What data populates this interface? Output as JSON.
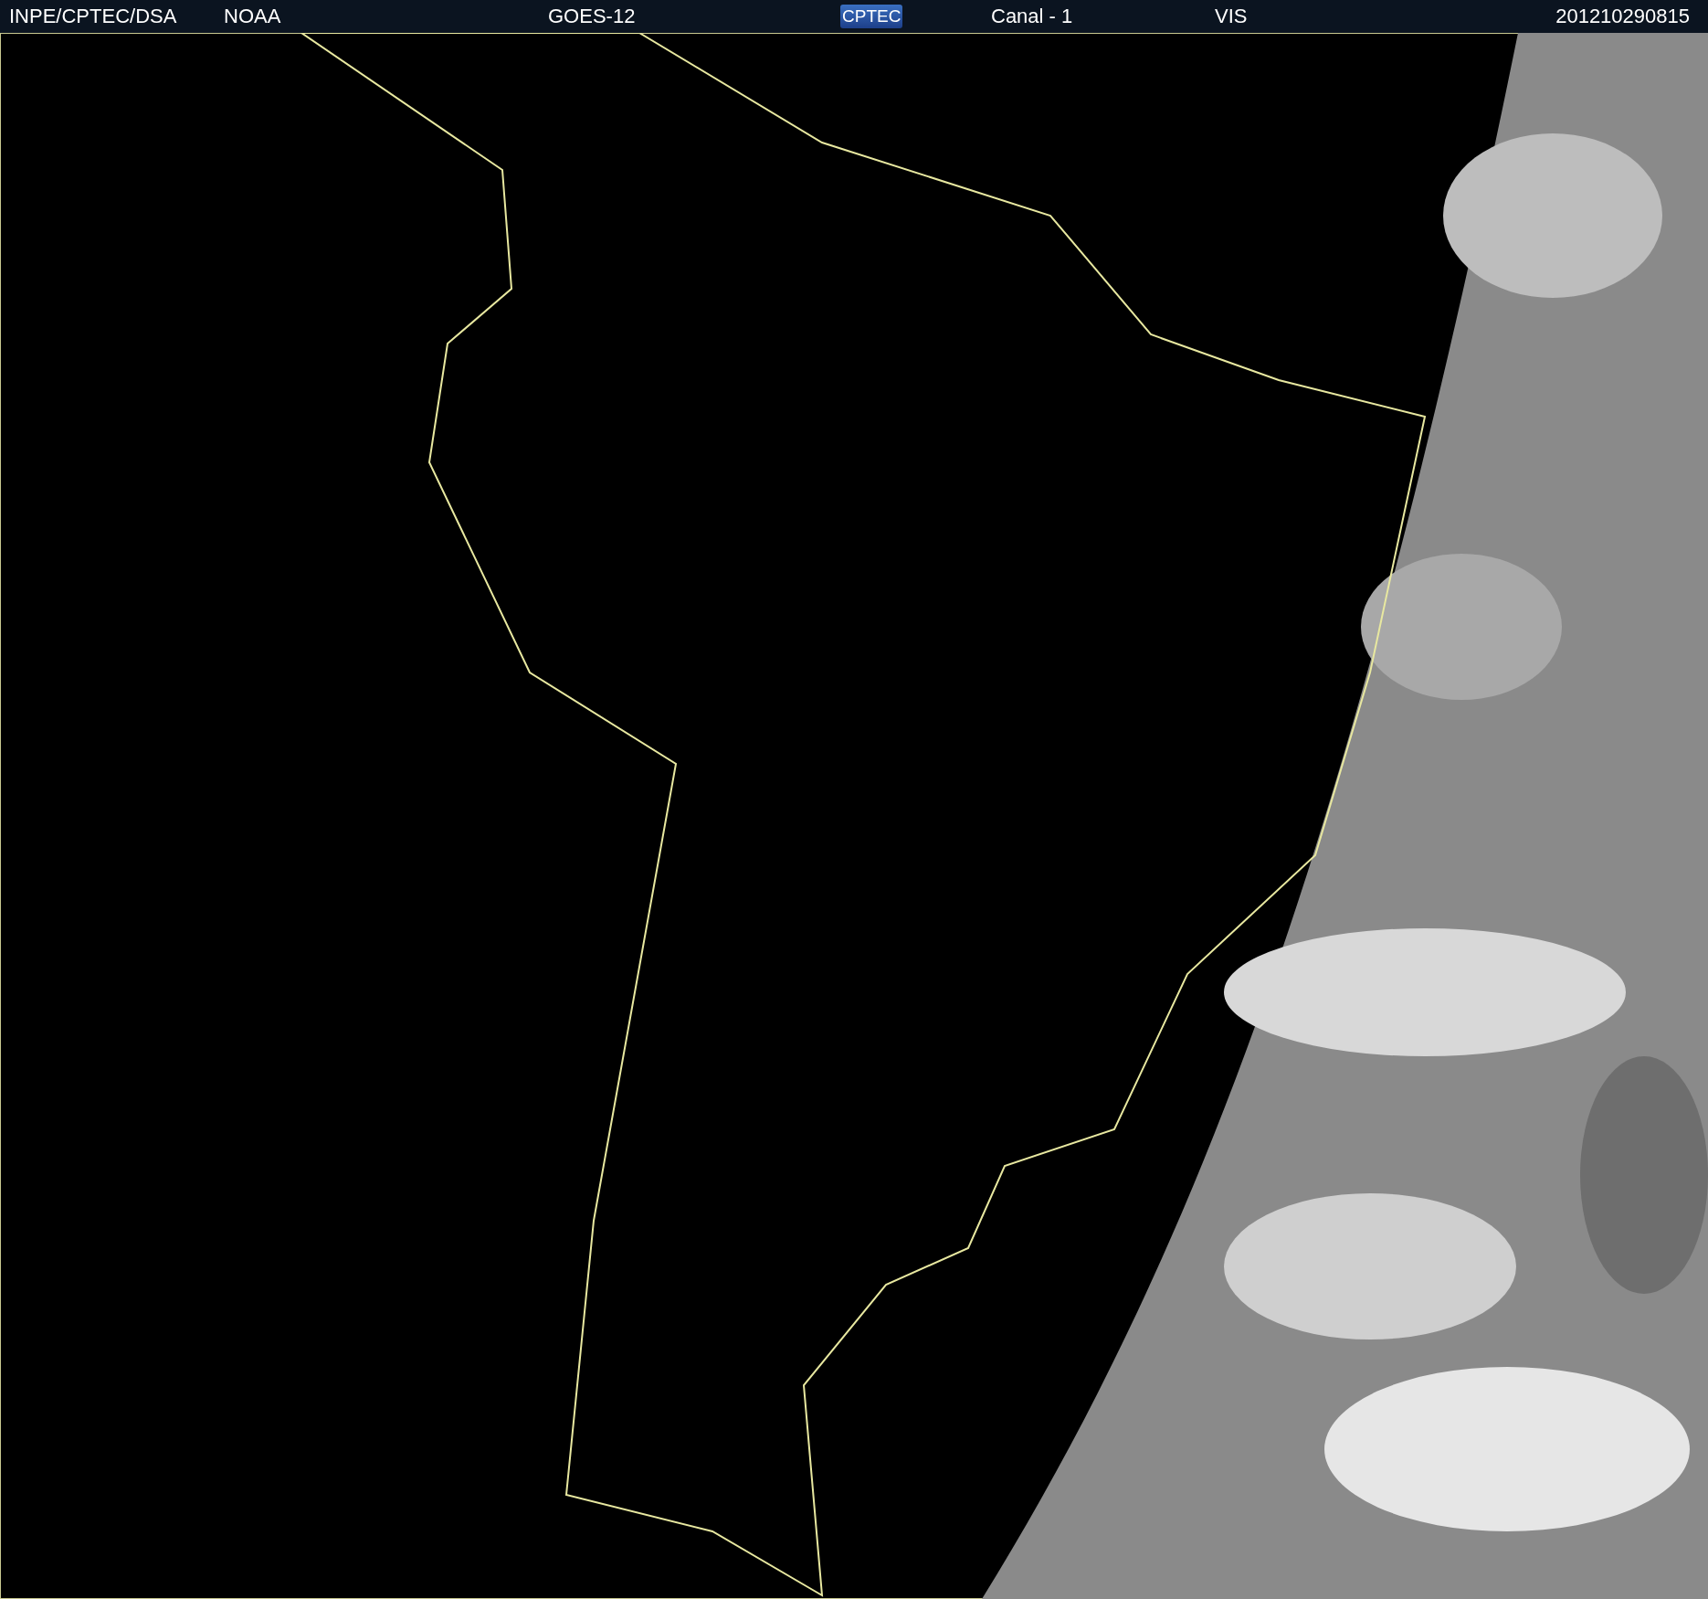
{
  "header": {
    "source": "INPE/CPTEC/DSA",
    "agency": "NOAA",
    "satellite": "GOES-12",
    "logo": "CPTEC",
    "channel": "Canal - 1",
    "band": "VIS",
    "timestamp": "201210290815"
  }
}
